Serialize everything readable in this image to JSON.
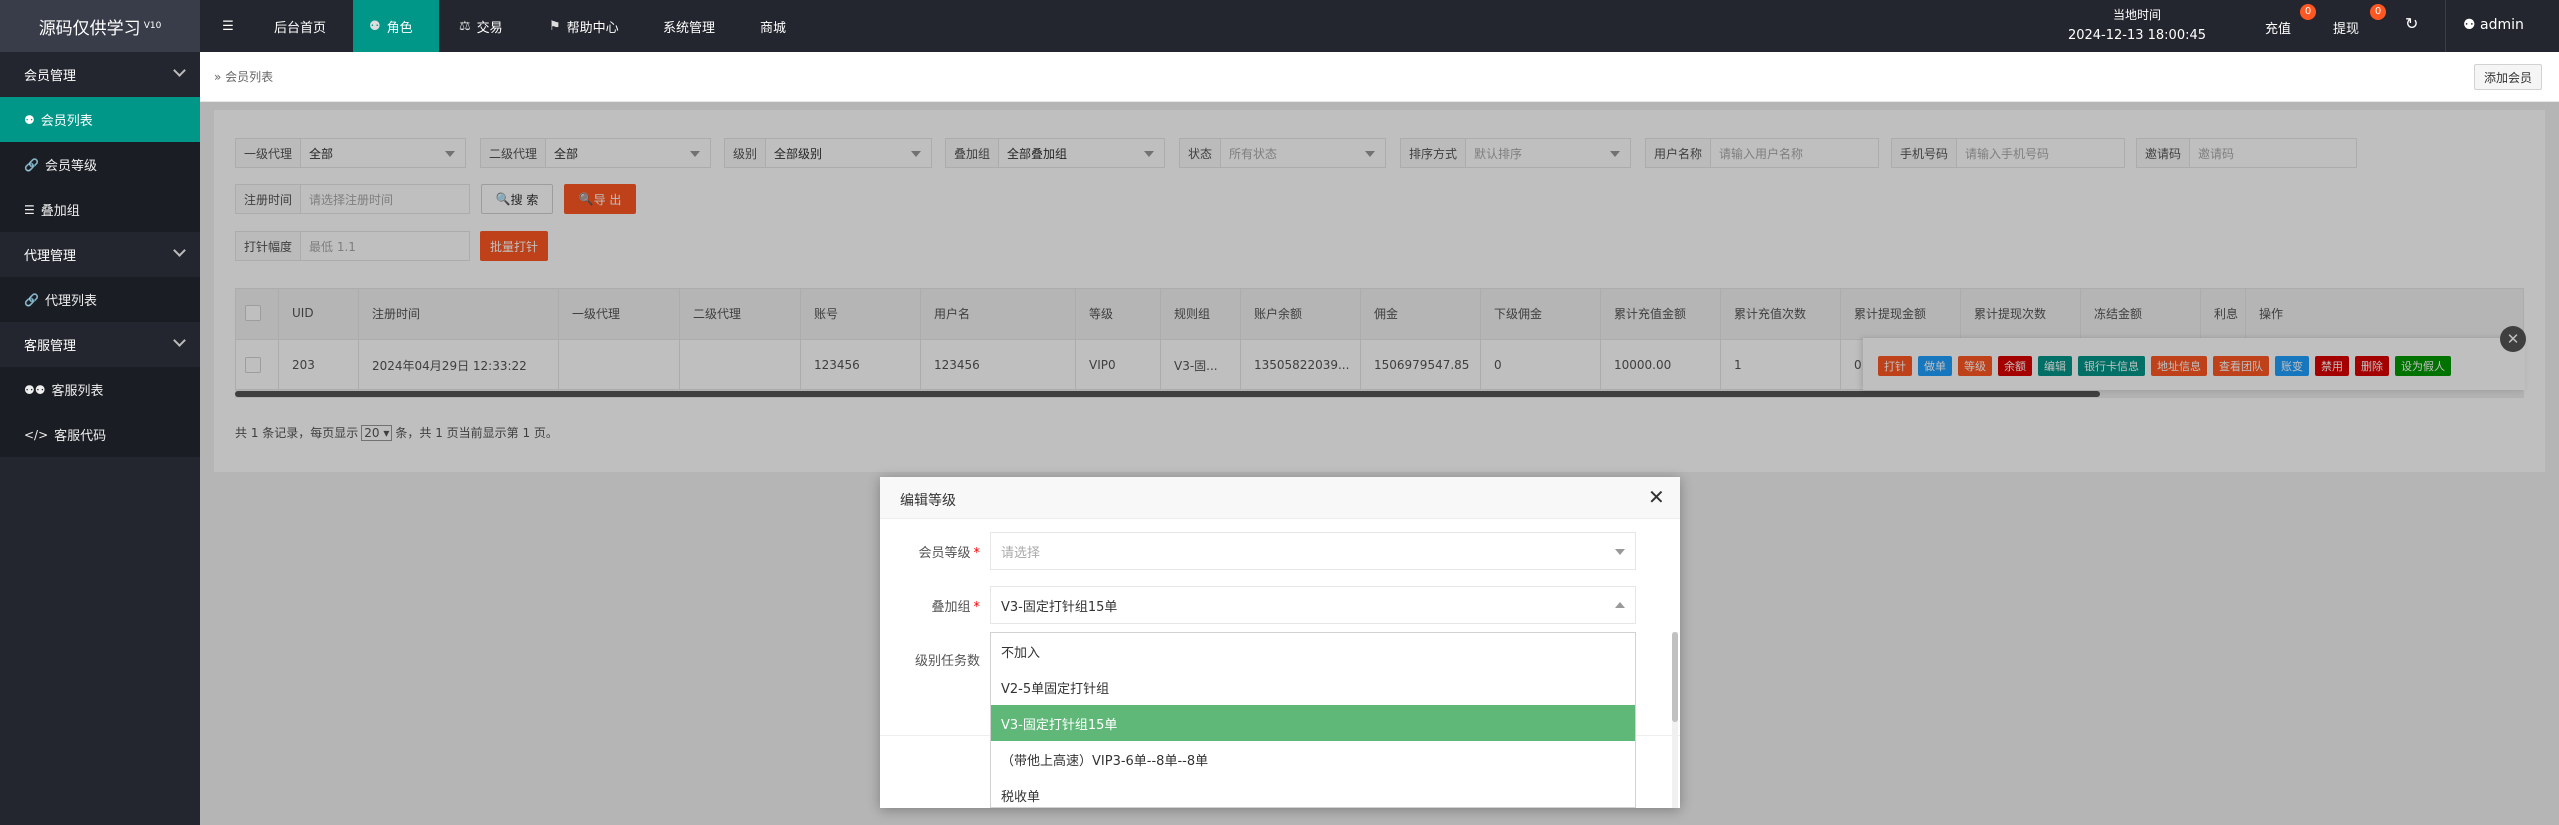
{
  "app": {
    "logo": "源码仅供学习",
    "logo_sup": "V10"
  },
  "topnav": {
    "items": [
      {
        "label": "后台首页",
        "icon": ""
      },
      {
        "label": "角色",
        "icon": "user-icon"
      },
      {
        "label": "交易",
        "icon": "scale-icon"
      },
      {
        "label": "帮助中心",
        "icon": "flag-icon"
      },
      {
        "label": "系统管理",
        "icon": ""
      },
      {
        "label": "商城",
        "icon": ""
      }
    ],
    "time_label": "当地时间",
    "time_value": "2024-12-13 18:00:45",
    "recharge": "充值",
    "recharge_badge": "0",
    "withdraw": "提现",
    "withdraw_badge": "0",
    "user": "admin"
  },
  "sidebar": {
    "groups": [
      {
        "label": "会员管理"
      },
      {
        "label": "代理管理"
      },
      {
        "label": "客服管理"
      }
    ],
    "items": [
      {
        "label": "会员列表"
      },
      {
        "label": "会员等级"
      },
      {
        "label": "叠加组"
      },
      {
        "label": "代理列表"
      },
      {
        "label": "客服列表"
      },
      {
        "label": "客服代码"
      }
    ]
  },
  "breadcrumb": {
    "current": "会员列表",
    "add_button": "添加会员"
  },
  "filters": {
    "agent1": {
      "label": "一级代理",
      "value": "全部"
    },
    "agent2": {
      "label": "二级代理",
      "value": "全部"
    },
    "level": {
      "label": "级别",
      "value": "全部级别"
    },
    "group": {
      "label": "叠加组",
      "value": "全部叠加组"
    },
    "status": {
      "label": "状态",
      "value": "所有状态"
    },
    "sort": {
      "label": "排序方式",
      "value": "默认排序"
    },
    "username": {
      "label": "用户名称",
      "placeholder": "请输入用户名称"
    },
    "phone": {
      "label": "手机号码",
      "placeholder": "请输入手机号码"
    },
    "invite": {
      "label": "邀请码",
      "placeholder": "邀请码"
    },
    "regtime": {
      "label": "注册时间",
      "placeholder": "请选择注册时间"
    },
    "search_button": "搜 索",
    "export_button": "导 出",
    "amplitude": {
      "label": "打针幅度",
      "placeholder": "最低 1.1"
    },
    "batch_button": "批量打针"
  },
  "table": {
    "headers": [
      "UID",
      "注册时间",
      "一级代理",
      "二级代理",
      "账号",
      "用户名",
      "等级",
      "规则组",
      "账户余额",
      "佣金",
      "下级佣金",
      "累计充值金额",
      "累计充值次数",
      "累计提现金额",
      "累计提现次数",
      "冻结金额",
      "利息",
      "操作"
    ],
    "row": [
      "203",
      "2024年04月29日 12:33:22",
      "",
      "",
      "123456",
      "123456",
      "VIP0",
      "V3-固...",
      "13505822039...",
      "1506979547.85",
      "0",
      "10000.00",
      "1",
      "0"
    ],
    "ops": [
      {
        "label": "打针",
        "color": "#ff5722"
      },
      {
        "label": "做单",
        "color": "#1e9fff"
      },
      {
        "label": "等级",
        "color": "#ff5722"
      },
      {
        "label": "余额",
        "color": "#dd0000"
      },
      {
        "label": "编辑",
        "color": "#009688"
      },
      {
        "label": "银行卡信息",
        "color": "#009688"
      },
      {
        "label": "地址信息",
        "color": "#ff5722"
      },
      {
        "label": "查看团队",
        "color": "#ff5722"
      },
      {
        "label": "账变",
        "color": "#1e9fff"
      },
      {
        "label": "禁用",
        "color": "#dd0000"
      },
      {
        "label": "删除",
        "color": "#dd0000"
      },
      {
        "label": "设为假人",
        "color": "#009900"
      }
    ]
  },
  "pagination": {
    "prefix": "共 1 条记录，每页显示",
    "page_size": "20",
    "suffix": "条，共 1 页当前显示第 1 页。"
  },
  "modal": {
    "title": "编辑等级",
    "level_label": "会员等级",
    "level_placeholder": "请选择",
    "group_label": "叠加组",
    "group_value": "V3-固定打针组15单",
    "tasks_label": "级别任务数",
    "options": [
      "不加入",
      "V2-5单固定打针组",
      "V3-固定打针组15单",
      "（带他上高速）VIP3-6单--8单--8单",
      "税收单"
    ],
    "selected_index": 2
  }
}
